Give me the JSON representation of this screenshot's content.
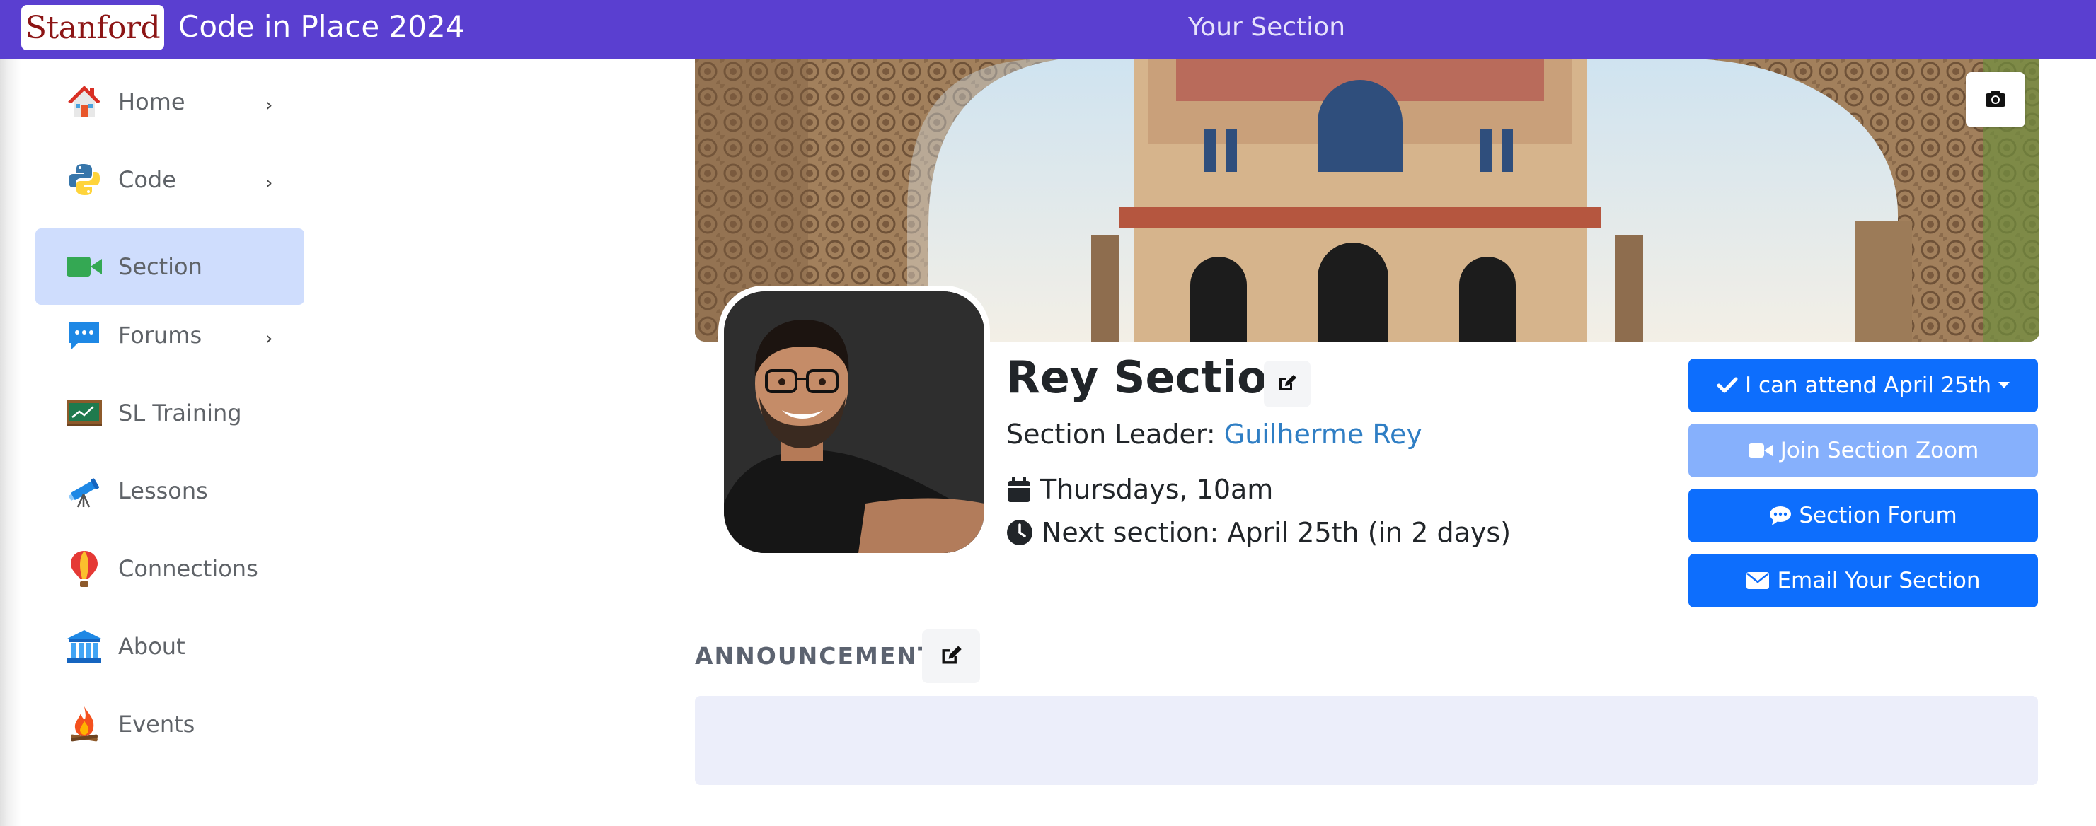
{
  "topbar": {
    "logo": "Stanford",
    "course_title": "Code in Place 2024",
    "page_title": "Your Section"
  },
  "sidebar": {
    "items": [
      {
        "label": "Home",
        "icon": "house-icon",
        "chevron": true
      },
      {
        "label": "Code",
        "icon": "python-icon",
        "chevron": true
      },
      {
        "label": "Section",
        "icon": "video-camera-icon",
        "chevron": false,
        "active": true
      },
      {
        "label": "Forums",
        "icon": "chat-bubble-icon",
        "chevron": true
      },
      {
        "label": "SL Training",
        "icon": "chalkboard-icon",
        "chevron": false
      },
      {
        "label": "Lessons",
        "icon": "telescope-icon",
        "chevron": false
      },
      {
        "label": "Connections",
        "icon": "hot-air-balloon-icon",
        "chevron": false
      },
      {
        "label": "About",
        "icon": "classical-building-icon",
        "chevron": false
      },
      {
        "label": "Events",
        "icon": "campfire-icon",
        "chevron": false
      }
    ]
  },
  "section": {
    "title": "Rey Section",
    "leader_prefix": "Section Leader: ",
    "leader_name": "Guilherme Rey",
    "schedule": "Thursdays, 10am",
    "next_section": "Next section: April 25th (in 2 days)"
  },
  "actions": {
    "attend": "I can attend April 25th",
    "join_zoom": "Join Section Zoom",
    "forum": "Section Forum",
    "email": "Email Your Section"
  },
  "announcements": {
    "label": "ANNOUNCEMENTS"
  },
  "colors": {
    "topbar": "#5a3fd0",
    "primary_button": "#0d6efd",
    "disabled_button": "#86b0fc",
    "active_nav": "#cfddfd",
    "link": "#2f7ec4"
  }
}
